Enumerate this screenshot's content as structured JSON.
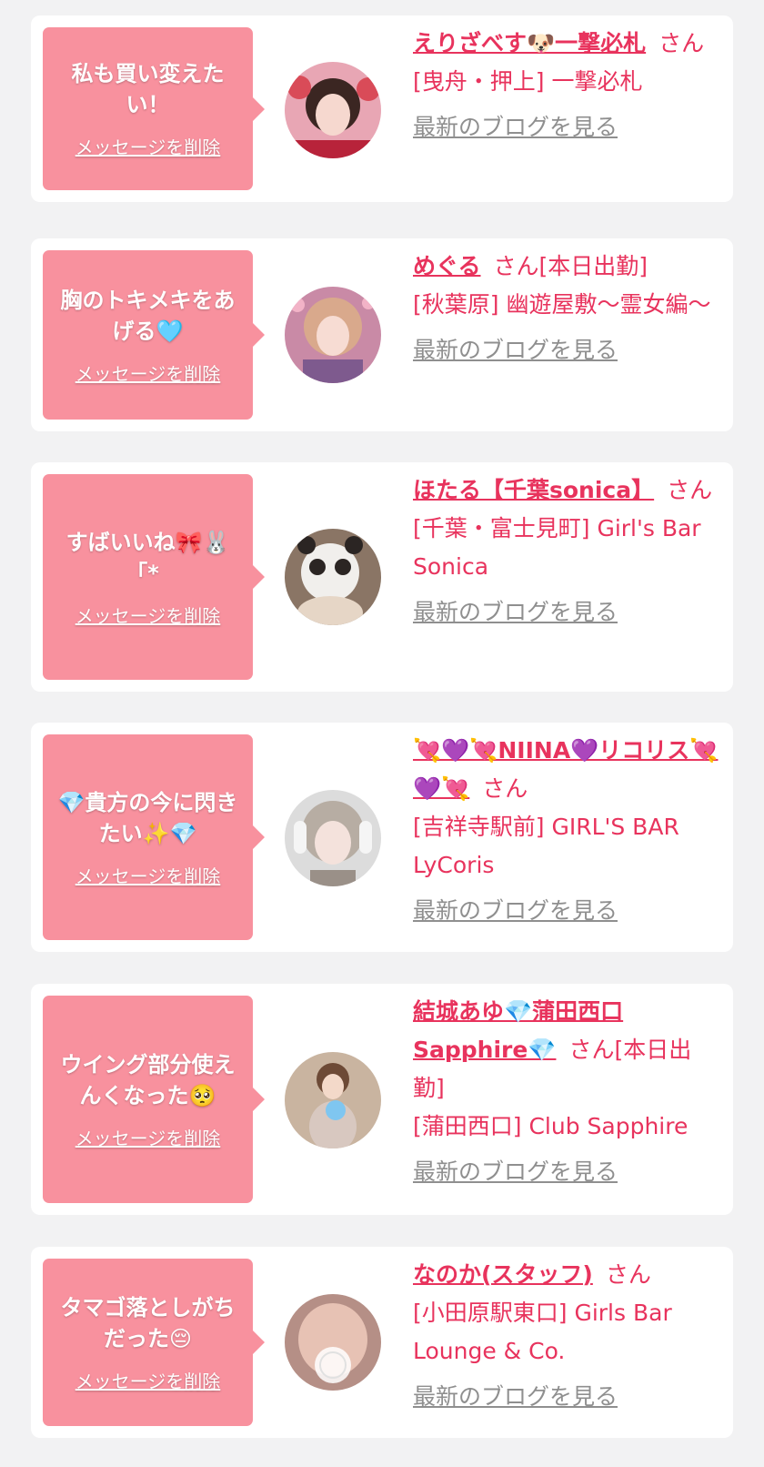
{
  "delete_label": "メッセージを削除",
  "blog_label": "最新のブログを見る",
  "honorific": "さん",
  "colors": {
    "accent": "#e8335d",
    "bubble": "#f8919e",
    "muted": "#8f8f8f",
    "background": "#f2f2f3"
  },
  "cards": [
    {
      "message": "私も買い変えたい！",
      "name": "えりざべす🐶一撃必札",
      "status": "",
      "shop": "[曳舟・押上] 一撃必札"
    },
    {
      "message": "胸のトキメキをあげる🩵",
      "name": "めぐる",
      "status": "[本日出勤]",
      "shop": "[秋葉原] 幽遊屋敷～霊女編～"
    },
    {
      "message": "すばいいね🎀🐰 ｢*",
      "name": "ほたる【千葉sonica】",
      "status": "",
      "shop": "[千葉・富士見町] Girl's Bar Sonica"
    },
    {
      "message": "💎貴方の今に閃きたい✨💎",
      "name": "💘💜💘NIINA💜リコリス💘💜💘",
      "status": "",
      "shop": "[吉祥寺駅前] GIRL'S BAR LyCoris"
    },
    {
      "message": "ウイング部分使えんくなった🥺",
      "name": "結城あゆ💎蒲田西口Sapphire💎",
      "status": "[本日出勤]",
      "shop": "[蒲田西口] Club Sapphire"
    },
    {
      "message": "タマゴ落としがちだった😔",
      "name": "なのか(スタッフ)",
      "status": "",
      "shop": "[小田原駅東口] Girls Bar Lounge & Co."
    }
  ]
}
